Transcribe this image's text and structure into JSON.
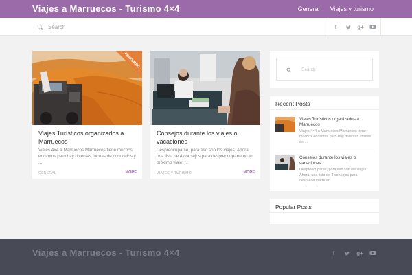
{
  "site": {
    "title": "Viajes a Marruecos - Turismo 4×4"
  },
  "nav": {
    "items": [
      {
        "label": "General"
      },
      {
        "label": "Viajes y turismo"
      }
    ]
  },
  "search": {
    "placeholder": "Search"
  },
  "social": {
    "icons": [
      "facebook-icon",
      "twitter-icon",
      "google-plus-icon",
      "youtube-icon"
    ]
  },
  "posts": [
    {
      "title": "Viajes Turísticos organizados a Marruecos",
      "excerpt": "Viajes 4×4 a Marruecos Marruecos tiene muchos encantos pero hay diversas formas de conocelos y ...",
      "category": "GENERAL",
      "more": "MORE",
      "badge": "FEATURED"
    },
    {
      "title": "Consejos durante los viajes o vacaciones",
      "excerpt": "Despreocuparse, para eso son los viajes. Ahora, una lista de 4 consejos para despreocuparte en tu próximo viaje: ...",
      "category": "VIAJES Y TURISMO",
      "more": "MORE"
    }
  ],
  "sidebar": {
    "search_placeholder": "Search",
    "recent_title": "Recent Posts",
    "recent": [
      {
        "title": "Viajes Turísticos organizados a Marruecos",
        "excerpt": "Viajes 4×4 a Marruecos Marruecos tiene muchos encantos pero hay diversas formas de ..."
      },
      {
        "title": "Consejos durante los viajes o vacaciones",
        "excerpt": "Despreocuparse, para eso son los viajes. Ahora, una lista de 4 consejos para despreocuparte en ..."
      }
    ],
    "popular_title": "Popular Posts"
  },
  "footer": {
    "title": "Viajes a Marruecos - Turismo 4×4"
  },
  "colors": {
    "accent": "#9a6ba8",
    "footer": "#484a56",
    "background": "#f2f2f2"
  }
}
